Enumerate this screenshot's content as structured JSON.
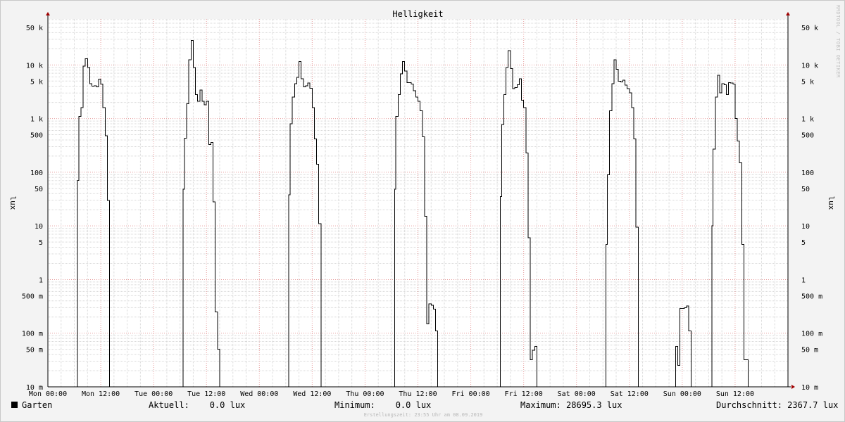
{
  "chart_data": {
    "type": "line",
    "title": "Helligkeit",
    "ylabel": "lux",
    "yscale": "log",
    "ylim": [
      0.01,
      100000
    ],
    "grid": true,
    "y_ticks": [
      {
        "value": 50000,
        "label": "50 k"
      },
      {
        "value": 10000,
        "label": "10 k"
      },
      {
        "value": 5000,
        "label": "5 k"
      },
      {
        "value": 1000,
        "label": "1 k"
      },
      {
        "value": 500,
        "label": "500"
      },
      {
        "value": 100,
        "label": "100"
      },
      {
        "value": 50,
        "label": "50"
      },
      {
        "value": 10,
        "label": "10"
      },
      {
        "value": 5,
        "label": "5"
      },
      {
        "value": 1,
        "label": "1"
      },
      {
        "value": 0.5,
        "label": "500 m"
      },
      {
        "value": 0.1,
        "label": "100 m"
      },
      {
        "value": 0.05,
        "label": "50 m"
      },
      {
        "value": 0.01,
        "label": "10 m"
      }
    ],
    "x_ticks": [
      {
        "hour": 0,
        "label": "Mon 00:00"
      },
      {
        "hour": 12,
        "label": "Mon 12:00"
      },
      {
        "hour": 24,
        "label": "Tue 00:00"
      },
      {
        "hour": 36,
        "label": "Tue 12:00"
      },
      {
        "hour": 48,
        "label": "Wed 00:00"
      },
      {
        "hour": 60,
        "label": "Wed 12:00"
      },
      {
        "hour": 72,
        "label": "Thu 00:00"
      },
      {
        "hour": 84,
        "label": "Thu 12:00"
      },
      {
        "hour": 96,
        "label": "Fri 00:00"
      },
      {
        "hour": 108,
        "label": "Fri 12:00"
      },
      {
        "hour": 120,
        "label": "Sat 00:00"
      },
      {
        "hour": 132,
        "label": "Sat 12:00"
      },
      {
        "hour": 144,
        "label": "Sun 00:00"
      },
      {
        "hour": 156,
        "label": "Sun 12:00"
      }
    ],
    "series": [
      {
        "name": "Garten",
        "color": "#000000",
        "x_hours": [
          6.3,
          6.7,
          7.0,
          7.5,
          8.0,
          8.5,
          9.0,
          9.5,
          10.0,
          10.5,
          11.0,
          11.5,
          12.0,
          12.5,
          13.0,
          13.5,
          14.0,
          14.5,
          15.0,
          15.5,
          16.0,
          16.5,
          17.0,
          17.5,
          18.0,
          18.5,
          19.0,
          19.5,
          20.0,
          30.3,
          30.7,
          31.0,
          31.5,
          32.0,
          32.5,
          33.0,
          33.5,
          34.0,
          34.5,
          35.0,
          35.5,
          36.0,
          36.5,
          37.0,
          37.5,
          38.0,
          38.5,
          39.0,
          39.5,
          40.0,
          40.5,
          41.0,
          41.5,
          42.0,
          42.5,
          43.0,
          43.5,
          44.0,
          44.5,
          54.3,
          54.7,
          55.0,
          55.5,
          56.0,
          56.5,
          57.0,
          57.5,
          58.0,
          58.5,
          59.0,
          59.5,
          60.0,
          60.5,
          61.0,
          61.5,
          62.0,
          62.5,
          63.0,
          63.5,
          64.0,
          64.5,
          65.0,
          65.5,
          78.3,
          78.7,
          79.0,
          79.5,
          80.0,
          80.5,
          81.0,
          81.5,
          82.0,
          82.5,
          83.0,
          83.5,
          84.0,
          84.5,
          85.0,
          85.5,
          86.0,
          86.5,
          87.0,
          87.5,
          88.0,
          88.5,
          89.0,
          89.5,
          90.0,
          90.5,
          91.0,
          91.5,
          92.0,
          92.5,
          93.0,
          102.3,
          102.7,
          103.0,
          103.5,
          104.0,
          104.5,
          105.0,
          105.5,
          106.0,
          106.5,
          107.0,
          107.5,
          108.0,
          108.5,
          109.0,
          109.5,
          110.0,
          110.5,
          111.0,
          111.5,
          112.0,
          112.5,
          113.0,
          113.5,
          114.0,
          114.5,
          115.0,
          115.5,
          116.0,
          126.3,
          126.7,
          127.0,
          127.5,
          128.0,
          128.5,
          129.0,
          129.5,
          130.0,
          130.5,
          131.0,
          131.5,
          132.0,
          132.5,
          133.0,
          133.5,
          134.0,
          134.5,
          135.0,
          135.5,
          136.0,
          136.5,
          137.0,
          137.5,
          138.0,
          138.5,
          139.0,
          139.5,
          140.0,
          140.5,
          142.5,
          143.0,
          143.5,
          144.0,
          144.5,
          145.0,
          145.5,
          146.0,
          146.5,
          147.0,
          147.5,
          148.0,
          148.5,
          150.3,
          150.7,
          151.0,
          151.5,
          152.0,
          152.5,
          153.0,
          153.5,
          154.0,
          154.5,
          155.0,
          155.5,
          156.0,
          156.5,
          157.0,
          157.5,
          158.0,
          158.5,
          159.0,
          159.5,
          160.0,
          160.5,
          161.0,
          161.5,
          162.0,
          162.5,
          163.0
        ],
        "y_lux": [
          0.01,
          70,
          1100,
          1600,
          9500,
          13000,
          9000,
          4500,
          4000,
          4100,
          3900,
          5400,
          4400,
          1600,
          480,
          30,
          0.01,
          0.01,
          0.01,
          0.01,
          0.01,
          0.01,
          0.01,
          0.01,
          0.01,
          0.01,
          0.01,
          0.01,
          0.01,
          0.01,
          48,
          430,
          1900,
          12500,
          28695.3,
          9000,
          2800,
          2100,
          3400,
          2100,
          1800,
          2100,
          330,
          360,
          28,
          0.25,
          0.05,
          0.01,
          0.01,
          0.01,
          0.01,
          0.01,
          0.01,
          0.01,
          0.01,
          0.01,
          0.01,
          0.01,
          0.01,
          0.01,
          38,
          800,
          2500,
          4500,
          5900,
          11500,
          5500,
          3900,
          4100,
          4600,
          3700,
          1600,
          420,
          140,
          11,
          0.01,
          0.01,
          0.01,
          0.01,
          0.01,
          0.01,
          0.01,
          0.01,
          0.01,
          48,
          1100,
          2800,
          6800,
          11500,
          7700,
          4700,
          4700,
          4400,
          3300,
          2500,
          2100,
          1400,
          460,
          15,
          0.15,
          0.35,
          0.33,
          0.28,
          0.11,
          0.01,
          0.01,
          0.01,
          0.01,
          0.01,
          0.01,
          0.01,
          0.01,
          0.01,
          0.01,
          0.01,
          35,
          780,
          2800,
          9000,
          18500,
          8500,
          3600,
          3800,
          4300,
          5500,
          2200,
          1600,
          230,
          6,
          0.032,
          0.048,
          0.057,
          0.01,
          0.01,
          0.01,
          0.01,
          0.01,
          0.01,
          0.01,
          0.01,
          0.01,
          0.01,
          0.01,
          0.01,
          4.5,
          90,
          1400,
          4500,
          12500,
          8300,
          5000,
          4800,
          5200,
          4200,
          3600,
          3000,
          1600,
          420,
          9.5,
          0.01,
          0.01,
          0.01,
          0.01,
          0.01,
          0.01,
          0.01,
          0.01,
          0.01,
          0.01,
          0.01,
          0.01,
          0.01,
          0.01,
          0.057,
          0.025,
          0.29,
          0.29,
          0.3,
          0.32,
          0.11,
          0.01,
          0.01,
          0.01,
          0.01,
          0.01,
          0.01,
          0.01,
          10,
          270,
          2500,
          6400,
          3000,
          4500,
          4300,
          2800,
          4700,
          4600,
          4400,
          1000,
          380,
          150,
          4.5,
          0.032,
          0.032,
          0.01,
          0.01,
          0.01,
          0.01,
          0.01,
          0.01,
          0.01,
          0.01,
          0.01
        ]
      }
    ]
  },
  "legend": {
    "series_name": "Garten",
    "aktuell": "Aktuell:    0.0 lux",
    "minimum": "Minimum:    0.0 lux",
    "maximum": "Maximum: 28695.3 lux",
    "durchschnitt": "Durchschnitt: 2367.7 lux"
  },
  "footer": "Erstellungszeit: 23:55 Uhr am 08.09.2019",
  "watermark": "RRDTOOL / TOBI OETIKER"
}
